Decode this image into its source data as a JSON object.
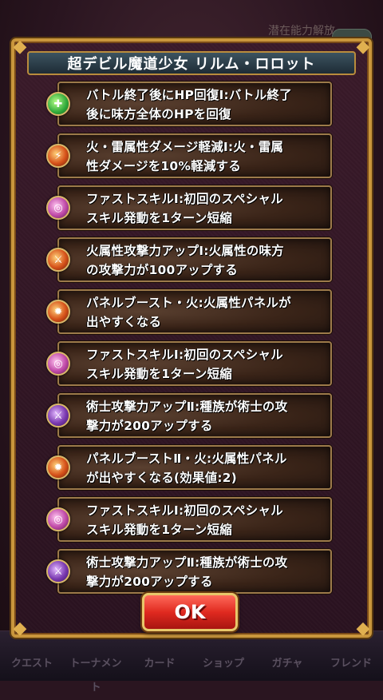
{
  "background": {
    "header_hint": "潜在能力解放",
    "tabs": [
      "クエスト",
      "トーナメント",
      "カード",
      "ショップ",
      "ガチャ",
      "フレンド"
    ]
  },
  "dialog": {
    "title": "超デビル魔道少女 リルム・ロロット",
    "abilities": [
      {
        "icon": "heal-orb-icon",
        "color": "#2ea83a",
        "text": "バトル終了後にHP回復Ⅰ:バトル終了\n後に味方全体のHPを回復"
      },
      {
        "icon": "fire-thunder-resist-icon",
        "color": "#d6521a",
        "text": "火・雷属性ダメージ軽減Ⅰ:火・雷属\n性ダメージを10%軽減する"
      },
      {
        "icon": "first-skill-icon",
        "color": "#c04aa8",
        "text": "ファストスキルⅠ:初回のスペシャル\nスキル発動を1ターン短縮"
      },
      {
        "icon": "fire-attack-up-icon",
        "color": "#d6521a",
        "text": "火属性攻撃力アップⅠ:火属性の味方\nの攻撃力が100アップする"
      },
      {
        "icon": "panel-boost-fire-icon",
        "color": "#d6521a",
        "text": "パネルブースト・火:火属性パネルが\n出やすくなる"
      },
      {
        "icon": "first-skill-icon",
        "color": "#c04aa8",
        "text": "ファストスキルⅠ:初回のスペシャル\nスキル発動を1ターン短縮"
      },
      {
        "icon": "mage-attack-up-icon",
        "color": "#7a3ab0",
        "text": "術士攻撃力アップⅡ:種族が術士の攻\n撃力が200アップする"
      },
      {
        "icon": "panel-boost-fire-icon",
        "color": "#d6521a",
        "text": "パネルブーストⅡ・火:火属性パネル\nが出やすくなる(効果値:2)"
      },
      {
        "icon": "first-skill-icon",
        "color": "#c04aa8",
        "text": "ファストスキルⅠ:初回のスペシャル\nスキル発動を1ターン短縮"
      },
      {
        "icon": "mage-attack-up-icon",
        "color": "#7a3ab0",
        "text": "術士攻撃力アップⅡ:種族が術士の攻\n撃力が200アップする"
      }
    ],
    "ok_label": "OK"
  }
}
